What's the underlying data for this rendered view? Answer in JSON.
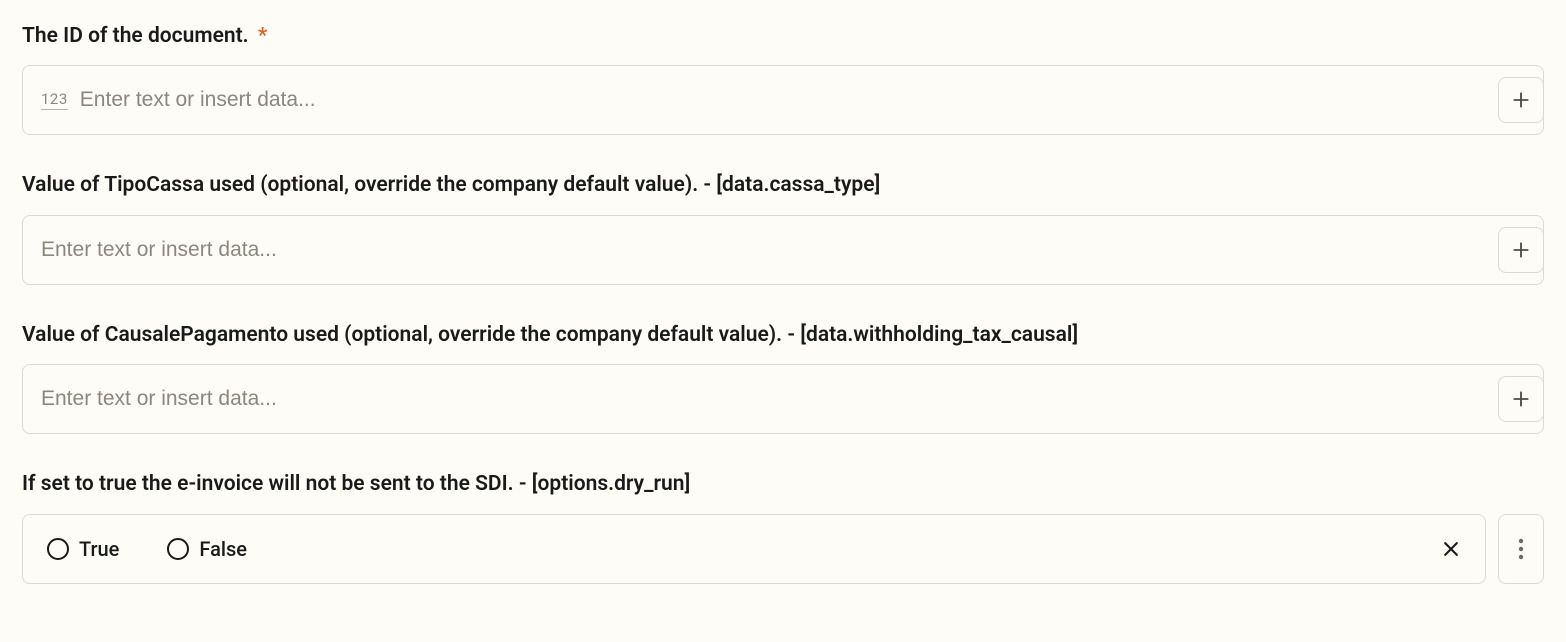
{
  "fields": {
    "document_id": {
      "label": "The ID of the document.",
      "required": true,
      "prefix": "123",
      "placeholder": "Enter text or insert data..."
    },
    "cassa_type": {
      "label": "Value of TipoCassa used (optional, override the company default value). - [data.cassa_type]",
      "placeholder": "Enter text or insert data..."
    },
    "withholding_tax_causal": {
      "label": "Value of CausalePagamento used (optional, override the company default value). - [data.withholding_tax_causal]",
      "placeholder": "Enter text or insert data..."
    },
    "dry_run": {
      "label": "If set to true the e-invoice will not be sent to the SDI. - [options.dry_run]",
      "option_true": "True",
      "option_false": "False"
    }
  },
  "required_marker": "*"
}
